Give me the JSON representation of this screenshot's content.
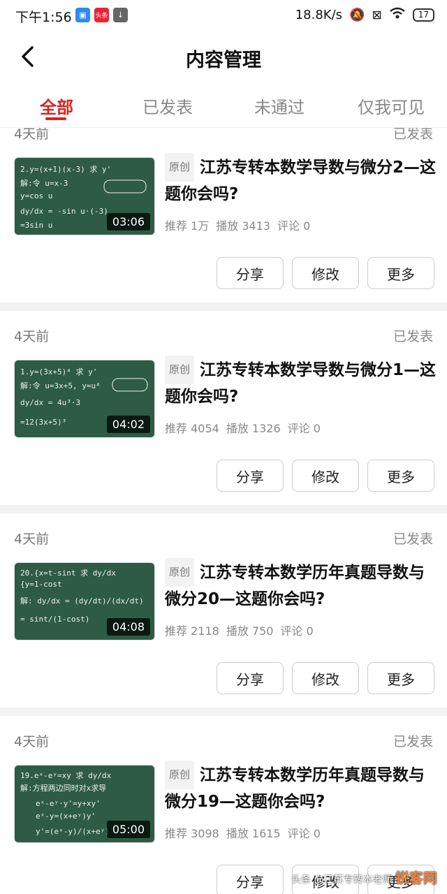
{
  "status_bar": {
    "time": "下午1:56",
    "network_speed": "18.8K/s",
    "battery": "17",
    "app_badge": "头条"
  },
  "header": {
    "title": "内容管理"
  },
  "tabs": [
    {
      "label": "全部",
      "active": true
    },
    {
      "label": "已发表",
      "active": false
    },
    {
      "label": "未通过",
      "active": false
    },
    {
      "label": "仅我可见",
      "active": false
    }
  ],
  "actions": {
    "share": "分享",
    "edit": "修改",
    "more": "更多"
  },
  "original_tag": "原创",
  "posts": [
    {
      "date": "4天前",
      "status": "已发表",
      "title": "江苏专转本数学导数与微分2—这题你会吗?",
      "duration": "03:06",
      "recommend": "推荐 1万",
      "plays": "播放 3413",
      "comments": "评论 0"
    },
    {
      "date": "4天前",
      "status": "已发表",
      "title": "江苏专转本数学导数与微分1—这题你会吗?",
      "duration": "04:02",
      "recommend": "推荐 4054",
      "plays": "播放 1326",
      "comments": "评论 0"
    },
    {
      "date": "4天前",
      "status": "已发表",
      "title": "江苏专转本数学历年真题导数与微分20—这题你会吗?",
      "duration": "04:08",
      "recommend": "推荐 2118",
      "plays": "播放 750",
      "comments": "评论 0"
    },
    {
      "date": "4天前",
      "status": "已发表",
      "title": "江苏专转本数学历年真题导数与微分19—这题你会吗?",
      "duration": "05:00",
      "recommend": "推荐 3098",
      "plays": "播放 1615",
      "comments": "评论 0"
    }
  ],
  "watermark": {
    "text": "头条 @江苏专转本老师",
    "logo": "锐客网"
  },
  "colors": {
    "accent": "#e02020",
    "board": "#2e5b46"
  }
}
